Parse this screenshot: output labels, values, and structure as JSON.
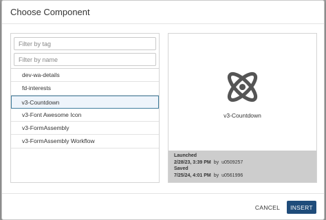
{
  "dialog": {
    "title": "Choose Component"
  },
  "filters": {
    "tag_placeholder": "Filter by tag",
    "name_placeholder": "Filter by name"
  },
  "components": [
    {
      "label": "dev-wa-details",
      "selected": false
    },
    {
      "label": "fd-interests",
      "selected": false
    },
    {
      "label": "v3-Countdown",
      "selected": true
    },
    {
      "label": "v3-Font Awesome Icon",
      "selected": false
    },
    {
      "label": "v3-FormAssembly",
      "selected": false
    },
    {
      "label": "v3-FormAssembly Workflow",
      "selected": false
    }
  ],
  "preview": {
    "icon": "atom-icon",
    "name": "v3-Countdown",
    "launched_label": "Launched",
    "launched_date": "2/28/23, 3:39 PM",
    "launched_by_label": "by",
    "launched_by": "u0509257",
    "saved_label": "Saved",
    "saved_date": "7/25/24, 4:01 PM",
    "saved_by_label": "by",
    "saved_by": "u0561996"
  },
  "buttons": {
    "cancel": "CANCEL",
    "insert": "INSERT"
  },
  "colors": {
    "primary": "#1f4c7a",
    "selected_border": "#3f7c9c",
    "icon": "#555555",
    "meta_bg": "#cdcdcd"
  }
}
